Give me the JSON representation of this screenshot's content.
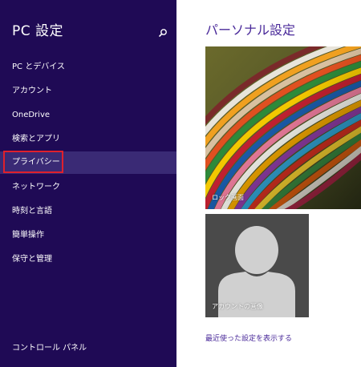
{
  "sidebar": {
    "title": "PC 設定",
    "search_icon": "search-icon",
    "items": [
      {
        "label": "PC とデバイス"
      },
      {
        "label": "アカウント"
      },
      {
        "label": "OneDrive"
      },
      {
        "label": "検索とアプリ"
      },
      {
        "label": "プライバシー",
        "selected": true
      },
      {
        "label": "ネットワーク"
      },
      {
        "label": "時刻と言語"
      },
      {
        "label": "簡単操作"
      },
      {
        "label": "保守と管理"
      }
    ],
    "footer_link": "コントロール パネル"
  },
  "main": {
    "title": "パーソナル設定",
    "lock_screen": {
      "caption": "ロック画面"
    },
    "account_picture": {
      "caption": "アカウントの画像"
    },
    "recent_link": "最近使った設定を表示する"
  },
  "colors": {
    "sidebar_bg": "#1f0a55",
    "selected_bg": "#3a2a75",
    "accent_text": "#4a2a9a",
    "highlight_border": "#e0202c"
  }
}
